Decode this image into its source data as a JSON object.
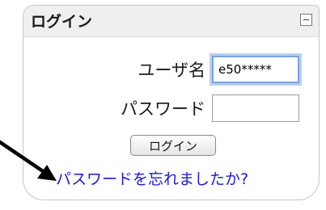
{
  "login_block": {
    "title": "ログイン",
    "username_label": "ユーザ名",
    "username_value": "e50*****",
    "password_label": "パスワード",
    "password_value": "",
    "login_button": "ログイン",
    "forgot_password_link": "パスワードを忘れましたか?",
    "collapse_icon": "minus-box-icon"
  },
  "annotation": {
    "icon": "arrow-icon",
    "color": "#000000"
  },
  "colors": {
    "link": "#1b1bcf",
    "header_bg": "#efefef",
    "focus_ring": "#7aa3d8"
  }
}
